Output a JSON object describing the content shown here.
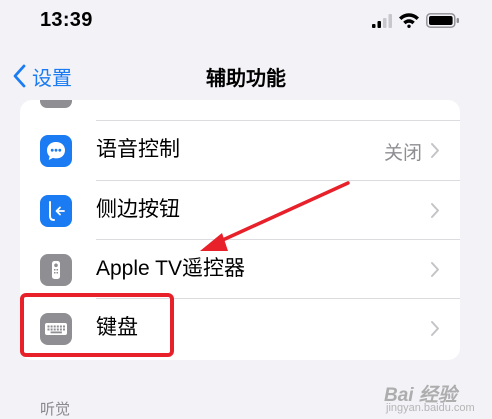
{
  "status_bar": {
    "time": "13:39"
  },
  "nav": {
    "back_label": "设置",
    "title": "辅助功能"
  },
  "rows": [
    {
      "label": "语音控制",
      "value": "关闭",
      "icon": "voice-control-icon"
    },
    {
      "label": "侧边按钮",
      "value": "",
      "icon": "side-button-icon"
    },
    {
      "label": "Apple TV遥控器",
      "value": "",
      "icon": "apple-tv-remote-icon"
    },
    {
      "label": "键盘",
      "value": "",
      "icon": "keyboard-icon"
    }
  ],
  "section_header": "听觉",
  "watermark": {
    "text": "Bai 经验",
    "sub": "jingyan.baidu.com"
  },
  "colors": {
    "accent": "#1a7bf2",
    "highlight": "#e8202a",
    "voice_icon": "#1a7bf2",
    "side_button_icon": "#1a7bf2",
    "remote_icon": "#8e8e93",
    "keyboard_icon": "#8e8e93"
  }
}
